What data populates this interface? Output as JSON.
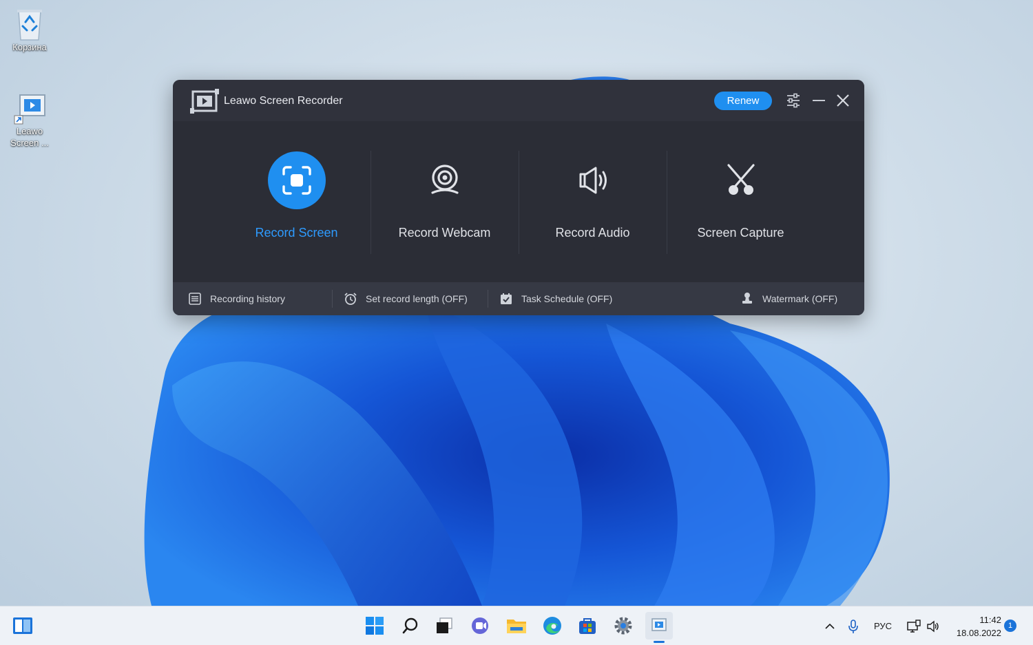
{
  "desktop": {
    "icons": [
      {
        "label": "Корзина"
      },
      {
        "label": "Leawo Screen ..."
      }
    ]
  },
  "window": {
    "title": "Leawo Screen Recorder",
    "renew_label": "Renew",
    "accent_color": "#1f8ff0"
  },
  "modes": [
    {
      "label": "Record Screen",
      "icon": "record-screen-icon",
      "active": true
    },
    {
      "label": "Record Webcam",
      "icon": "webcam-icon",
      "active": false
    },
    {
      "label": "Record Audio",
      "icon": "speaker-icon",
      "active": false
    },
    {
      "label": "Screen Capture",
      "icon": "scissors-icon",
      "active": false
    }
  ],
  "bottombar": {
    "recording_history": "Recording history",
    "record_length": "Set record length (OFF)",
    "task_schedule": "Task Schedule (OFF)",
    "watermark": "Watermark (OFF)"
  },
  "taskbar": {
    "language": "РУС",
    "time": "11:42",
    "date": "18.08.2022",
    "notifications": "1"
  }
}
